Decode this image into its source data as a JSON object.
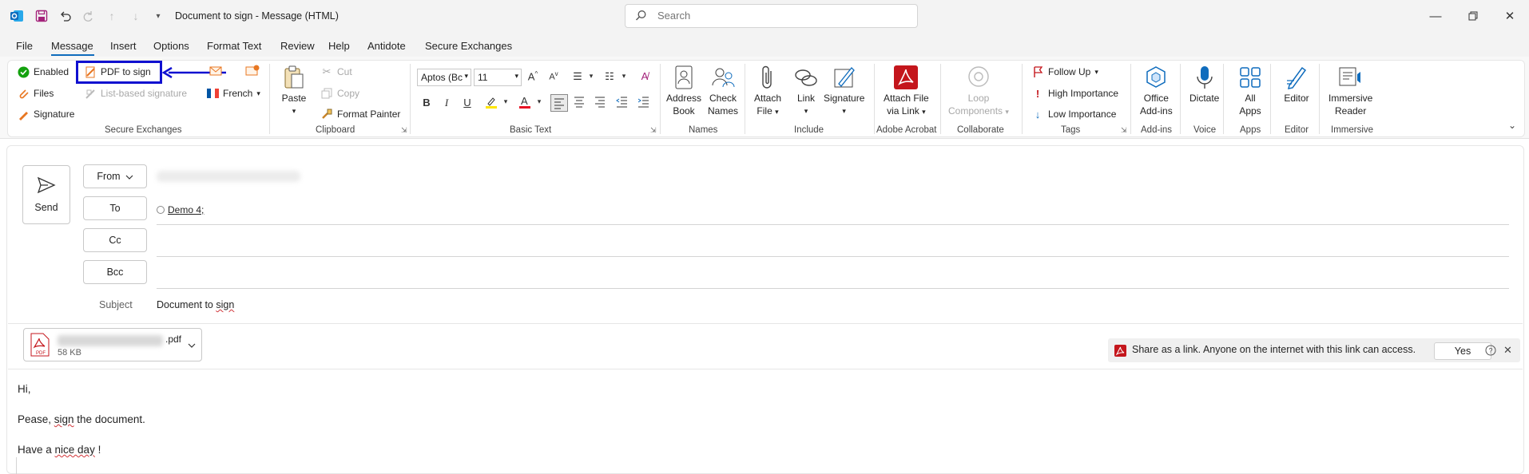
{
  "titlebar": {
    "window_title": "Document to sign  -  Message (HTML)",
    "search_placeholder": "Search"
  },
  "menu": {
    "items": [
      "File",
      "Message",
      "Insert",
      "Options",
      "Format Text",
      "Review",
      "Help",
      "Antidote",
      "Secure Exchanges"
    ],
    "active": "Message"
  },
  "ribbon": {
    "secure_exchanges": {
      "enabled": "Enabled",
      "pdf_to_sign": "PDF to sign",
      "files": "Files",
      "list_based_signature": "List-based signature",
      "signature": "Signature",
      "language": "French",
      "label": "Secure Exchanges"
    },
    "clipboard": {
      "paste": "Paste",
      "cut": "Cut",
      "copy": "Copy",
      "format_painter": "Format Painter",
      "label": "Clipboard"
    },
    "basic_text": {
      "font_name": "Aptos (Bc",
      "font_size": "11",
      "label": "Basic Text"
    },
    "names": {
      "address_book": [
        "Address",
        "Book"
      ],
      "check_names": [
        "Check",
        "Names"
      ],
      "label": "Names"
    },
    "include": {
      "attach_file": [
        "Attach",
        "File"
      ],
      "link": "Link",
      "signature": "Signature",
      "label": "Include"
    },
    "adobe": {
      "attach_via_link": [
        "Attach File",
        "via Link"
      ],
      "label": "Adobe Acrobat"
    },
    "collaborate": {
      "loop": [
        "Loop",
        "Components"
      ],
      "label": "Collaborate"
    },
    "tags": {
      "follow_up": "Follow Up",
      "high": "High Importance",
      "low": "Low Importance",
      "label": "Tags"
    },
    "addins": {
      "office": [
        "Office",
        "Add-ins"
      ],
      "label": "Add-ins"
    },
    "voice": {
      "dictate": "Dictate",
      "label": "Voice"
    },
    "apps": {
      "all_apps": [
        "All",
        "Apps"
      ],
      "label": "Apps"
    },
    "editor": {
      "editor": "Editor",
      "label": "Editor"
    },
    "immersive": {
      "reader": [
        "Immersive",
        "Reader"
      ],
      "label": "Immersive"
    }
  },
  "compose": {
    "send": "Send",
    "from_label": "From",
    "to_label": "To",
    "cc_label": "Cc",
    "bcc_label": "Bcc",
    "recipient": "Demo 4;",
    "subject_label": "Subject",
    "subject_pre": "Document to ",
    "subject_word": "sign"
  },
  "attachment": {
    "ext": ".pdf",
    "size": "58 KB",
    "badge": "PDF"
  },
  "share_bar": {
    "message": "Share as a link. Anyone on the internet with this link can access.",
    "yes": "Yes"
  },
  "body": {
    "line1": "Hi,",
    "line2_a": "Pease, ",
    "line2_b": "sign",
    "line2_c": " the document.",
    "line3_a": "Have a ",
    "line3_b": "nice day",
    "line3_c": " !"
  },
  "colors": {
    "accent": "#0f6cbd",
    "highlight_box": "#1010d0",
    "adobe_red": "#c4161c",
    "orange": "#e87722"
  }
}
